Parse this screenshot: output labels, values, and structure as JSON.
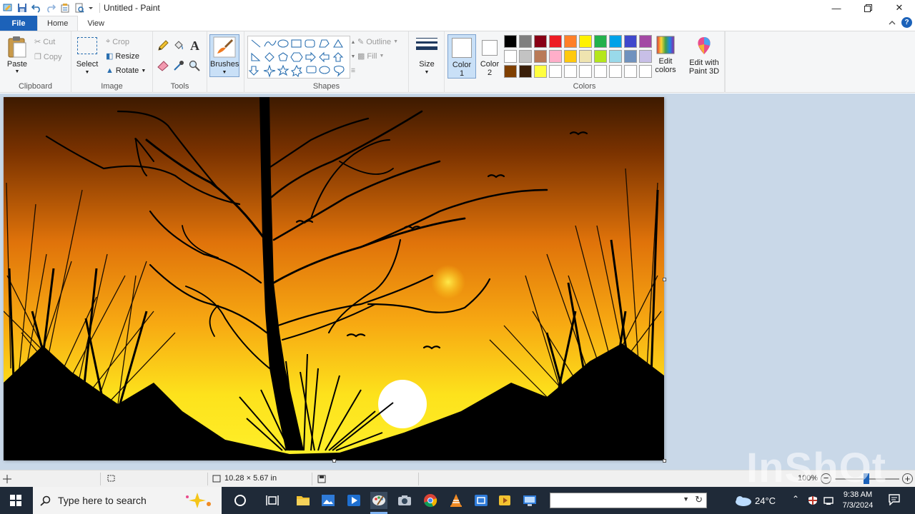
{
  "window": {
    "title": "Untitled - Paint"
  },
  "tabs": {
    "file": "File",
    "home": "Home",
    "view": "View"
  },
  "clipboard": {
    "paste": "Paste",
    "cut": "Cut",
    "copy": "Copy",
    "group": "Clipboard"
  },
  "image": {
    "select": "Select",
    "crop": "Crop",
    "resize": "Resize",
    "rotate": "Rotate",
    "group": "Image"
  },
  "tools": {
    "group": "Tools"
  },
  "brushes": {
    "label": "Brushes"
  },
  "shapes": {
    "outline": "Outline",
    "fill": "Fill",
    "group": "Shapes"
  },
  "size": {
    "label": "Size"
  },
  "colors": {
    "color1_label": "Color",
    "color1_num": "1",
    "color2_label": "Color",
    "color2_num": "2",
    "edit_colors_1": "Edit",
    "edit_colors_2": "colors",
    "group": "Colors",
    "palette": [
      "#000000",
      "#7f7f7f",
      "#880015",
      "#ed1c24",
      "#ff7f27",
      "#fff200",
      "#22b14c",
      "#00a2e8",
      "#3f48cc",
      "#a349a4",
      "#ffffff",
      "#c3c3c3",
      "#b97a57",
      "#ffaec9",
      "#ffc90e",
      "#efe4b0",
      "#b5e61d",
      "#99d9ea",
      "#7092be",
      "#c8bfe7",
      "#7f3f00",
      "#3a1f0a",
      "#ffff40",
      "#ffffff",
      "#ffffff",
      "#ffffff",
      "#ffffff",
      "#ffffff",
      "#ffffff",
      "#ffffff"
    ]
  },
  "paint3d": {
    "line1": "Edit with",
    "line2": "Paint 3D"
  },
  "status": {
    "dimensions": "10.28 × 5.67 in",
    "zoom": "100%"
  },
  "taskbar": {
    "search_placeholder": "Type here to search",
    "weather": "24°C",
    "time": "9:38 AM",
    "date": "7/3/2024"
  },
  "watermark": "InShOt"
}
